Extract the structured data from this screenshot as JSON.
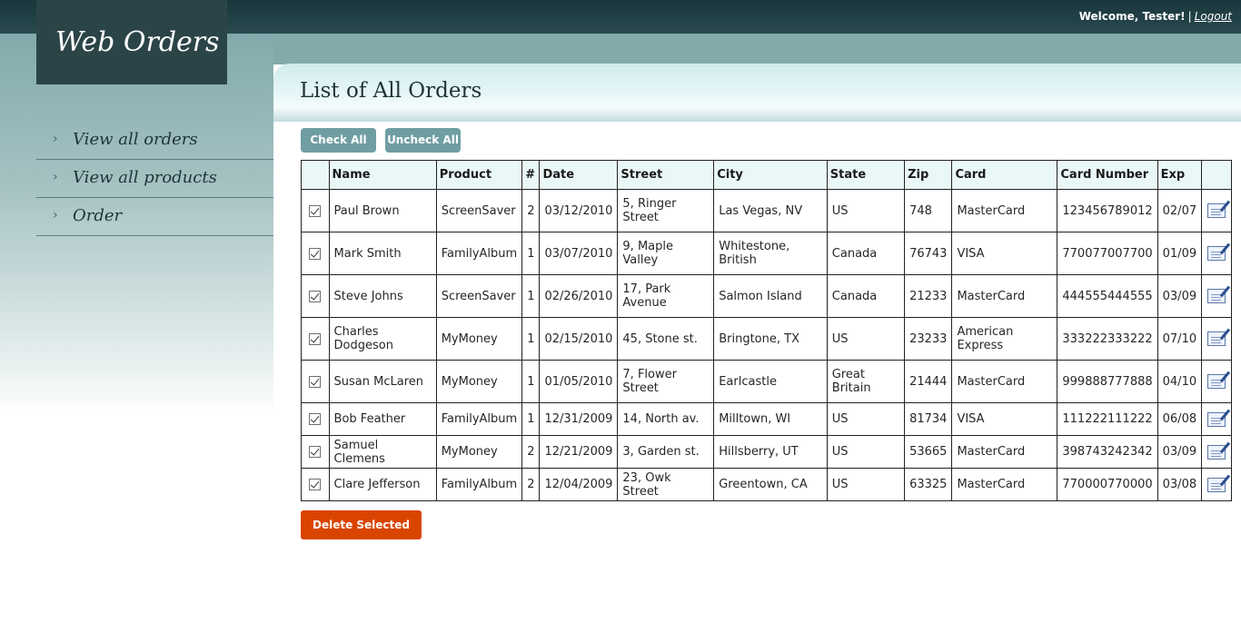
{
  "header": {
    "welcome": "Welcome, Tester!",
    "separator": "|",
    "logout": "Logout"
  },
  "logo": "Web Orders",
  "nav": {
    "items": [
      {
        "label": "View all orders"
      },
      {
        "label": "View all products"
      },
      {
        "label": "Order"
      }
    ]
  },
  "main": {
    "title": "List of All Orders",
    "check_all": "Check All",
    "uncheck_all": "Uncheck All",
    "delete_selected": "Delete Selected"
  },
  "table": {
    "columns": [
      "Name",
      "Product",
      "#",
      "Date",
      "Street",
      "City",
      "State",
      "Zip",
      "Card",
      "Card Number",
      "Exp"
    ],
    "rows": [
      {
        "name": "Paul Brown",
        "product": "ScreenSaver",
        "qty": "2",
        "date": "03/12/2010",
        "street": "5, Ringer Street",
        "city": "Las Vegas, NV",
        "state": "US",
        "zip": "748",
        "card": "MasterCard",
        "card_number": "123456789012",
        "exp": "02/07",
        "checked": true
      },
      {
        "name": "Mark Smith",
        "product": "FamilyAlbum",
        "qty": "1",
        "date": "03/07/2010",
        "street": "9, Maple Valley",
        "city": "Whitestone, British",
        "state": "Canada",
        "zip": "76743",
        "card": "VISA",
        "card_number": "770077007700",
        "exp": "01/09",
        "checked": true
      },
      {
        "name": "Steve Johns",
        "product": "ScreenSaver",
        "qty": "1",
        "date": "02/26/2010",
        "street": "17, Park Avenue",
        "city": "Salmon Island",
        "state": "Canada",
        "zip": "21233",
        "card": "MasterCard",
        "card_number": "444555444555",
        "exp": "03/09",
        "checked": true
      },
      {
        "name": "Charles Dodgeson",
        "product": "MyMoney",
        "qty": "1",
        "date": "02/15/2010",
        "street": "45, Stone st.",
        "city": "Bringtone, TX",
        "state": "US",
        "zip": "23233",
        "card": "American Express",
        "card_number": "333222333222",
        "exp": "07/10",
        "checked": true
      },
      {
        "name": "Susan McLaren",
        "product": "MyMoney",
        "qty": "1",
        "date": "01/05/2010",
        "street": "7, Flower Street",
        "city": "Earlcastle",
        "state": "Great Britain",
        "zip": "21444",
        "card": "MasterCard",
        "card_number": "999888777888",
        "exp": "04/10",
        "checked": true
      },
      {
        "name": "Bob Feather",
        "product": "FamilyAlbum",
        "qty": "1",
        "date": "12/31/2009",
        "street": "14, North av.",
        "city": "Milltown, WI",
        "state": "US",
        "zip": "81734",
        "card": "VISA",
        "card_number": "111222111222",
        "exp": "06/08",
        "checked": true
      },
      {
        "name": "Samuel Clemens",
        "product": "MyMoney",
        "qty": "2",
        "date": "12/21/2009",
        "street": "3, Garden st.",
        "city": "Hillsberry, UT",
        "state": "US",
        "zip": "53665",
        "card": "MasterCard",
        "card_number": "398743242342",
        "exp": "03/09",
        "checked": true
      },
      {
        "name": "Clare Jefferson",
        "product": "FamilyAlbum",
        "qty": "2",
        "date": "12/04/2009",
        "street": "23, Owk Street",
        "city": "Greentown, CA",
        "state": "US",
        "zip": "63325",
        "card": "MasterCard",
        "card_number": "770000770000",
        "exp": "03/08",
        "checked": true
      }
    ]
  },
  "icons": {
    "nav_chevron": "chevron-right-icon",
    "row_edit": "edit-icon",
    "row_checkbox": "checkbox-checked"
  },
  "colors": {
    "topbar": "#1e3d42",
    "logo_bg": "#2b4447",
    "sidebar": "#82aaab",
    "accent_button": "#6f9ea2",
    "delete_button": "#d94500"
  }
}
